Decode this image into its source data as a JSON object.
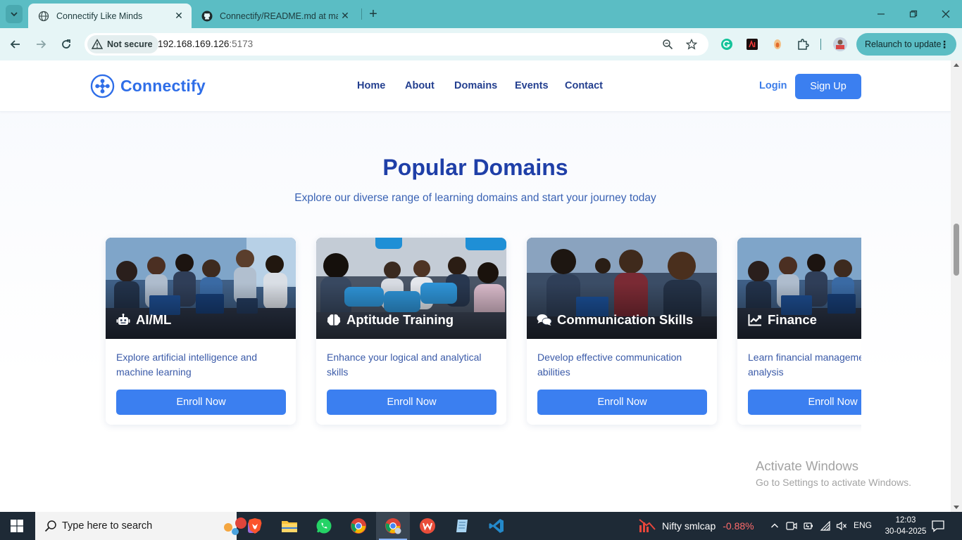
{
  "browser": {
    "tabs": [
      {
        "title": "Connectify Like Minds",
        "active": true,
        "favicon": "globe-icon"
      },
      {
        "title": "Connectify/README.md at mai",
        "active": false,
        "favicon": "github-icon"
      }
    ],
    "security_label": "Not secure",
    "url_host": "192.168.169.126",
    "url_port": ":5173",
    "relaunch_label": "Relaunch to update"
  },
  "site": {
    "brand": "Connectify",
    "nav": [
      "Home",
      "About",
      "Domains",
      "Events",
      "Contact"
    ],
    "login": "Login",
    "signup": "Sign Up"
  },
  "section": {
    "title": "Popular Domains",
    "subtitle": "Explore our diverse range of learning domains and start your journey today"
  },
  "domains": [
    {
      "name": "AI/ML",
      "icon": "robot-icon",
      "description": "Explore artificial intelligence and machine learning",
      "button": "Enroll Now"
    },
    {
      "name": "Aptitude Training",
      "icon": "brain-icon",
      "description": "Enhance your logical and analytical skills",
      "button": "Enroll Now"
    },
    {
      "name": "Communication Skills",
      "icon": "comments-icon",
      "description": "Develop effective communication abilities",
      "button": "Enroll Now"
    },
    {
      "name": "Finance",
      "icon": "chart-line-icon",
      "description": "Learn financial management and analysis",
      "button": "Enroll Now"
    }
  ],
  "watermark": {
    "line1": "Activate Windows",
    "line2": "Go to Settings to activate Windows."
  },
  "taskbar": {
    "search_placeholder": "Type here to search",
    "ticker_name": "Nifty smlcap",
    "ticker_change": "-0.88%",
    "language": "ENG",
    "time": "12:03",
    "date": "30-04-2025"
  },
  "colors": {
    "accent": "#3b7ff0",
    "heading": "#1f3fa8",
    "tabbar": "#5bbdc4",
    "ticker_negative": "#ff6b6b"
  }
}
